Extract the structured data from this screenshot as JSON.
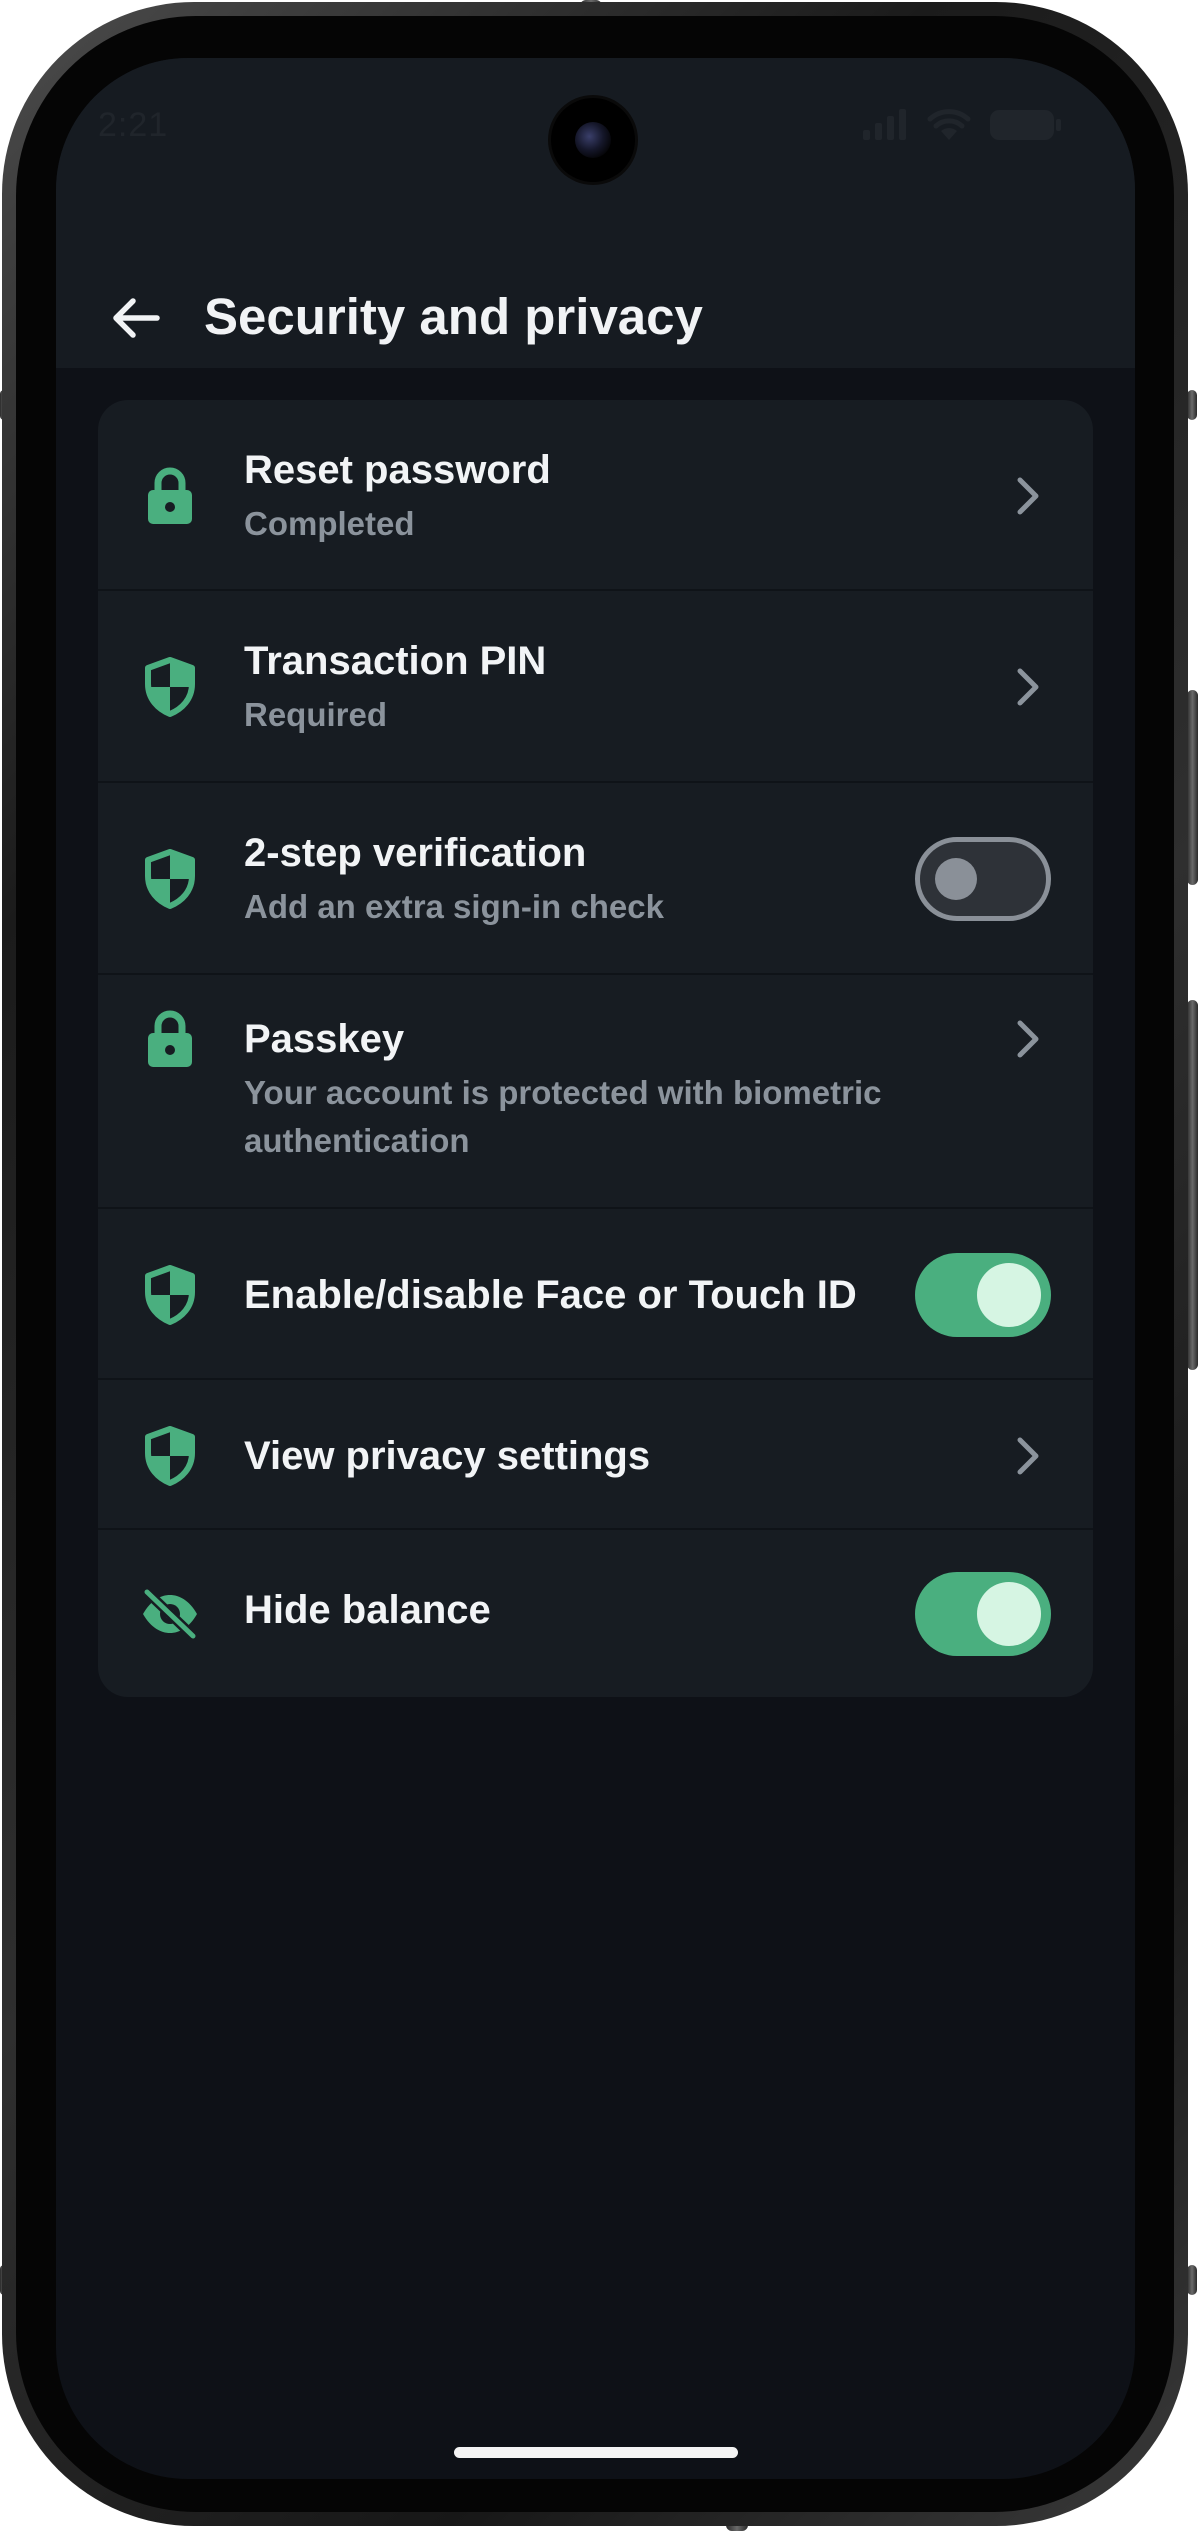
{
  "status_bar": {
    "time": "2:21",
    "icons": [
      "signal-icon",
      "wifi-icon",
      "battery-icon"
    ]
  },
  "header": {
    "back_icon": "arrow-left-icon",
    "title": "Security and privacy"
  },
  "settings": [
    {
      "icon": "lock-icon",
      "title": "Reset password",
      "subtitle": "Completed",
      "control": "chevron"
    },
    {
      "icon": "shield-icon",
      "title": "Transaction PIN",
      "subtitle": "Required",
      "control": "chevron"
    },
    {
      "icon": "shield-icon",
      "title": "2-step verification",
      "subtitle": "Add an extra sign-in check",
      "control": "toggle",
      "enabled": false
    },
    {
      "icon": "lock-icon",
      "title": "Passkey",
      "subtitle": "Your account is protected with biometric authentication",
      "control": "chevron"
    },
    {
      "icon": "shield-icon",
      "title": "Enable/disable Face or Touch ID",
      "control": "toggle",
      "enabled": true
    },
    {
      "icon": "shield-icon",
      "title": "View privacy settings",
      "control": "chevron"
    },
    {
      "icon": "eye-off-icon",
      "title": "Hide balance",
      "control": "toggle",
      "enabled": true
    }
  ],
  "colors": {
    "accent": "#4aaf7f",
    "background": "#0e1117",
    "card": "#171c22",
    "header": "#161b21",
    "text_primary": "#f2f4f6",
    "text_secondary": "#8b939c"
  }
}
